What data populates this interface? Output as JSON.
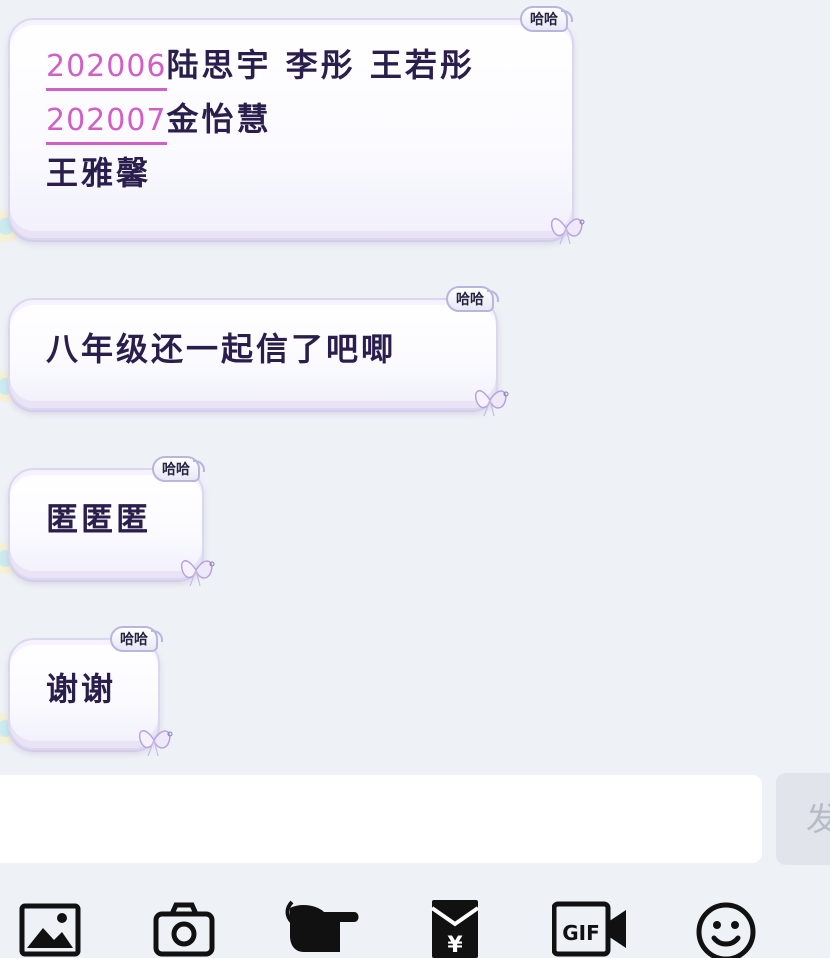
{
  "messages": [
    {
      "tag": "哈哈",
      "lines": [
        {
          "date": "202006",
          "text": "陆思宇 李彤 王若彤"
        },
        {
          "date": "202007",
          "text": "金怡慧"
        },
        {
          "date": "",
          "text": "王雅馨"
        }
      ]
    },
    {
      "tag": "哈哈",
      "text": "八年级还一起信了吧唧"
    },
    {
      "tag": "哈哈",
      "text": "匿匿匿"
    },
    {
      "tag": "哈哈",
      "text": "谢谢"
    }
  ],
  "input": {
    "value": "",
    "send_label": "发"
  },
  "toolbar": {
    "icons": [
      "image-icon",
      "camera-icon",
      "poke-icon",
      "red-packet-icon",
      "gif-icon",
      "emoji-icon"
    ],
    "gif_label": "GIF",
    "yen_label": "¥"
  },
  "colors": {
    "background": "#eef1f6",
    "bubble_border": "#dcd7ef",
    "text": "#2a1e4c",
    "date": "#d15fc6",
    "send_button": "#e1e4ea",
    "icon": "#111111"
  }
}
